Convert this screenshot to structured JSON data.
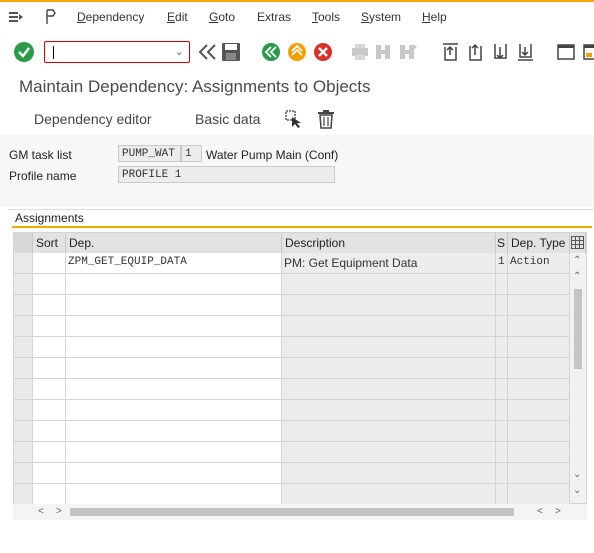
{
  "menu": {
    "items": [
      {
        "label": "Dependency",
        "underline": "D",
        "rest": "ependency"
      },
      {
        "label": "Edit",
        "underline": "E",
        "rest": "dit"
      },
      {
        "label": "Goto",
        "underline": "G",
        "rest": "oto"
      },
      {
        "label": "Extras",
        "underline": "",
        "rest": "Extras"
      },
      {
        "label": "Tools",
        "underline": "T",
        "rest": "ools"
      },
      {
        "label": "System",
        "underline": "S",
        "rest": "ystem"
      },
      {
        "label": "Help",
        "underline": "H",
        "rest": "elp"
      }
    ]
  },
  "toolbar": {
    "command_value": "",
    "colors": {
      "confirm": "#2a9a4a",
      "back": "#2a9a4a",
      "exit": "#f0a000",
      "cancel": "#d9302c",
      "accent": "#f0ab00"
    }
  },
  "page": {
    "title": "Maintain Dependency: Assignments to Objects",
    "app_buttons": [
      "Dependency editor",
      "Basic data"
    ]
  },
  "header": {
    "task_list_label": "GM task list",
    "task_list_value": "PUMP_WAT",
    "task_list_counter": "1",
    "task_list_description": "Water Pump Main (Conf)",
    "profile_label": "Profile name",
    "profile_value": "PROFILE 1"
  },
  "assignments": {
    "title": "Assignments",
    "columns": [
      "Sort",
      "Dep.",
      "Description",
      "S",
      "Dep. Type"
    ],
    "rows": [
      {
        "sort": "",
        "dep": "ZPM_GET_EQUIP_DATA",
        "description": "PM: Get Equipment Data",
        "s": "1",
        "type": "Action"
      }
    ],
    "empty_row_count": 11
  }
}
